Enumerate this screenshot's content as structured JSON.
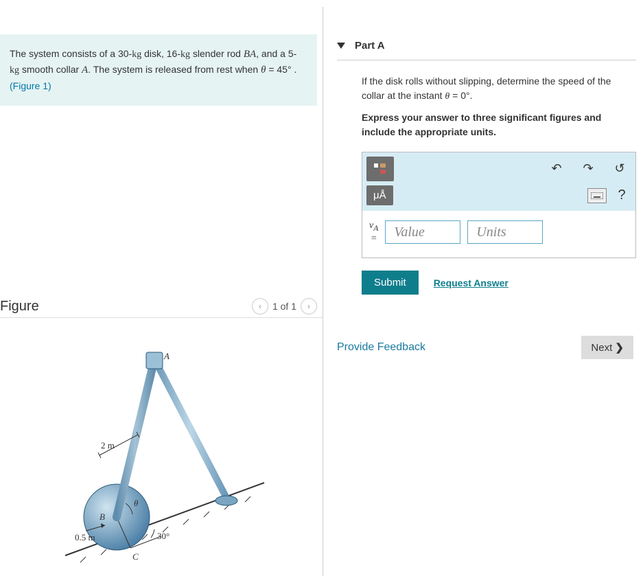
{
  "problem": {
    "text_prefix": "The system consists of a 30-",
    "kg1": "kg",
    "text_mid1": " disk, 16-",
    "kg2": "kg",
    "text_mid2": " slender rod ",
    "rod": "BA",
    "text_mid3": ", and a 5-",
    "kg3": "kg",
    "text_mid4": " smooth collar ",
    "collar": "A",
    "text_mid5": ". The system is released from rest when ",
    "theta": "θ",
    "text_eq": " = 45° . ",
    "figlink": "(Figure 1)"
  },
  "figure": {
    "title": "Figure",
    "counter": "1 of 1",
    "labels": {
      "A": "A",
      "B": "B",
      "C": "C",
      "len": "2 m",
      "radius": "0.5 m",
      "theta": "θ",
      "angle30": "30°"
    }
  },
  "part": {
    "title": "Part A",
    "question_prefix": "If the disk rolls without slipping, determine the speed of the collar at the instant ",
    "question_theta": "θ",
    "question_suffix": " = 0°.",
    "instruction": "Express your answer to three significant figures and include the appropriate units.",
    "toolbar": {
      "template_icon": "▯▯",
      "undo": "↶",
      "redo": "↷",
      "reset": "↺",
      "mu": "μÅ",
      "keyboard": "⌨",
      "help": "?"
    },
    "var_html_top": "v",
    "var_html_sub": "A",
    "equals": "=",
    "value_placeholder": "Value",
    "units_placeholder": "Units",
    "submit": "Submit",
    "request": "Request Answer"
  },
  "footer": {
    "feedback": "Provide Feedback",
    "next": "Next"
  }
}
